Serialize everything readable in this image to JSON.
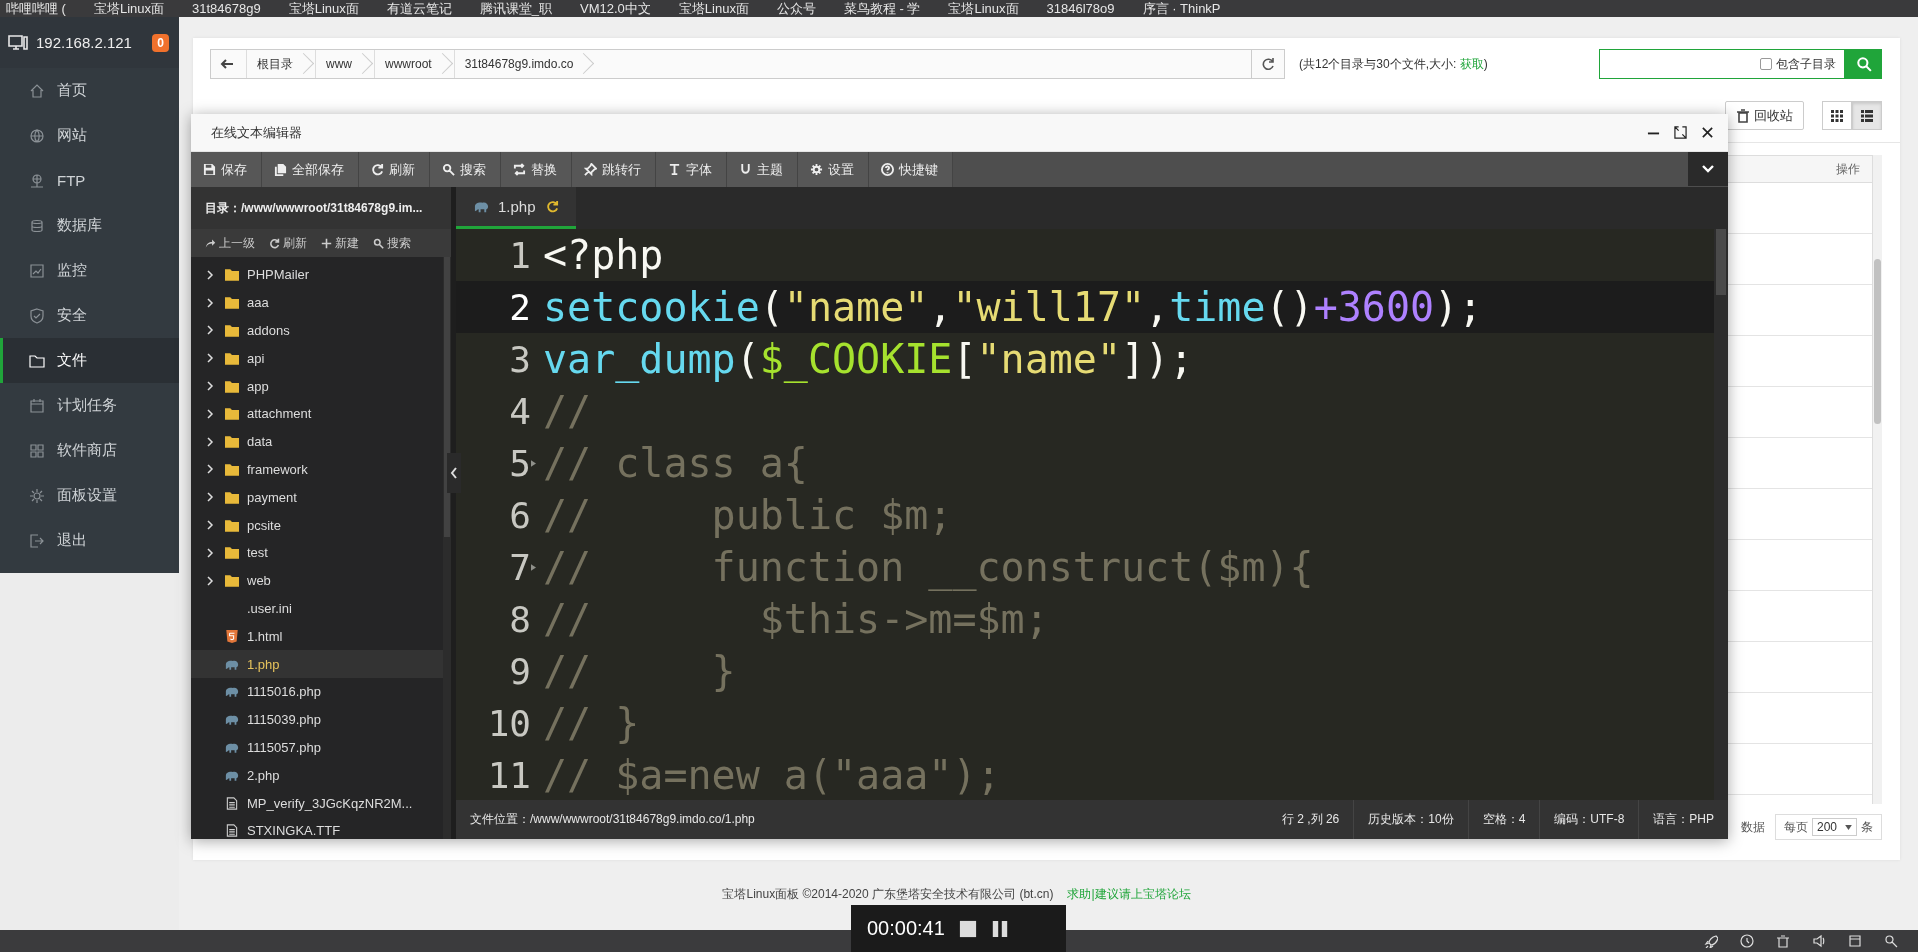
{
  "bookmarks": [
    {
      "label": "哔哩哔哩 ("
    },
    {
      "label": "宝塔Linux面"
    },
    {
      "label": "31t84678g9"
    },
    {
      "label": "宝塔Linux面"
    },
    {
      "label": "有道云笔记"
    },
    {
      "label": "腾讯课堂_职"
    },
    {
      "label": "VM12.0中文"
    },
    {
      "label": "宝塔Linux面"
    },
    {
      "label": "公众号"
    },
    {
      "label": "菜鸟教程 - 学"
    },
    {
      "label": "宝塔Linux面"
    },
    {
      "label": "31846l78o9"
    },
    {
      "label": "序言 · ThinkP"
    }
  ],
  "sidebar": {
    "host": "192.168.2.121",
    "badge": "0",
    "items": [
      {
        "label": "首页",
        "selected": false
      },
      {
        "label": "网站",
        "selected": false
      },
      {
        "label": "FTP",
        "selected": false
      },
      {
        "label": "数据库",
        "selected": false
      },
      {
        "label": "监控",
        "selected": false
      },
      {
        "label": "安全",
        "selected": false
      },
      {
        "label": "文件",
        "selected": true
      },
      {
        "label": "计划任务",
        "selected": false
      },
      {
        "label": "软件商店",
        "selected": false
      },
      {
        "label": "面板设置",
        "selected": false
      },
      {
        "label": "退出",
        "selected": false
      }
    ]
  },
  "breadcrumb": {
    "parts": [
      "根目录",
      "www",
      "wwwroot",
      "31t84678g9.imdo.co"
    ],
    "summary_start": "(共12个目录与30个文件,大小: ",
    "summary_link": "获取",
    "summary_end": ")"
  },
  "search": {
    "checkbox_label": "包含子目录",
    "checked": false
  },
  "page_toolbar": {
    "recycle": "回收站",
    "views": [
      {
        "selected": false
      },
      {
        "selected": true
      }
    ]
  },
  "table": {
    "header": "操作"
  },
  "pager": {
    "count_tail": "数据",
    "per_page_label": "每页",
    "per_page": "200",
    "unit": "条"
  },
  "editor": {
    "title": "在线文本编辑器",
    "toolbar": [
      "保存",
      "全部保存",
      "刷新",
      "搜索",
      "替换",
      "跳转行",
      "字体",
      "主题",
      "设置",
      "快捷键"
    ],
    "directory": "目录：/www/wwwroot/31t84678g9.im...",
    "actions": [
      "上一级",
      "刷新",
      "新建",
      "搜索"
    ],
    "tree": [
      {
        "name": "PHPMailer",
        "kind": "folder",
        "expanded": false,
        "selected": false
      },
      {
        "name": "aaa",
        "kind": "folder",
        "expanded": false,
        "selected": false
      },
      {
        "name": "addons",
        "kind": "folder",
        "expanded": false,
        "selected": false
      },
      {
        "name": "api",
        "kind": "folder",
        "expanded": false,
        "selected": false
      },
      {
        "name": "app",
        "kind": "folder",
        "expanded": false,
        "selected": false
      },
      {
        "name": "attachment",
        "kind": "folder",
        "expanded": false,
        "selected": false
      },
      {
        "name": "data",
        "kind": "folder",
        "expanded": false,
        "selected": false
      },
      {
        "name": "framework",
        "kind": "folder",
        "expanded": false,
        "selected": false
      },
      {
        "name": "payment",
        "kind": "folder",
        "expanded": false,
        "selected": false
      },
      {
        "name": "pcsite",
        "kind": "folder",
        "expanded": false,
        "selected": false
      },
      {
        "name": "test",
        "kind": "folder",
        "expanded": false,
        "selected": false
      },
      {
        "name": "web",
        "kind": "folder",
        "expanded": false,
        "selected": false
      },
      {
        "name": ".user.ini",
        "kind": "plain",
        "selected": false
      },
      {
        "name": "1.html",
        "kind": "html",
        "selected": false
      },
      {
        "name": "1.php",
        "kind": "php",
        "selected": true
      },
      {
        "name": "1115016.php",
        "kind": "php",
        "selected": false
      },
      {
        "name": "1115039.php",
        "kind": "php",
        "selected": false
      },
      {
        "name": "1115057.php",
        "kind": "php",
        "selected": false
      },
      {
        "name": "2.php",
        "kind": "php",
        "selected": false
      },
      {
        "name": "MP_verify_3JGcKqzNR2M...",
        "kind": "document",
        "selected": false
      },
      {
        "name": "STXINGKA.TTF",
        "kind": "document",
        "selected": false
      }
    ],
    "tabs": [
      {
        "label": "1.php",
        "selected": true
      }
    ],
    "lines": [
      {
        "number": "1",
        "current": false,
        "foldable": false,
        "tokens": [
          {
            "t": "<?php",
            "kind": "plain"
          }
        ]
      },
      {
        "number": "2",
        "current": true,
        "foldable": false,
        "tokens": [
          {
            "t": "setcookie",
            "kind": "func"
          },
          {
            "t": "(",
            "kind": "plain"
          },
          {
            "t": "\"name\"",
            "kind": "string"
          },
          {
            "t": ",",
            "kind": "plain"
          },
          {
            "t": "\"will17\"",
            "kind": "string"
          },
          {
            "t": ",",
            "kind": "plain"
          },
          {
            "t": "time",
            "kind": "func"
          },
          {
            "t": "()",
            "kind": "plain"
          },
          {
            "t": "+3600",
            "kind": "number"
          },
          {
            "t": ");",
            "kind": "plain"
          }
        ]
      },
      {
        "number": "3",
        "current": false,
        "foldable": false,
        "tokens": [
          {
            "t": "var_dump",
            "kind": "func"
          },
          {
            "t": "(",
            "kind": "plain"
          },
          {
            "t": "$_COOKIE",
            "kind": "var"
          },
          {
            "t": "[",
            "kind": "plain"
          },
          {
            "t": "\"name\"",
            "kind": "string"
          },
          {
            "t": "]);",
            "kind": "plain"
          }
        ]
      },
      {
        "number": "4",
        "current": false,
        "foldable": false,
        "tokens": [
          {
            "t": "//",
            "kind": "comment"
          }
        ]
      },
      {
        "number": "5",
        "current": false,
        "foldable": true,
        "tokens": [
          {
            "t": "// class a{",
            "kind": "comment"
          }
        ]
      },
      {
        "number": "6",
        "current": false,
        "foldable": false,
        "tokens": [
          {
            "t": "//     public $m;",
            "kind": "comment"
          }
        ]
      },
      {
        "number": "7",
        "current": false,
        "foldable": true,
        "tokens": [
          {
            "t": "//     function __construct($m){",
            "kind": "comment"
          }
        ]
      },
      {
        "number": "8",
        "current": false,
        "foldable": false,
        "tokens": [
          {
            "t": "//       $this->m=$m;",
            "kind": "comment"
          }
        ]
      },
      {
        "number": "9",
        "current": false,
        "foldable": false,
        "tokens": [
          {
            "t": "//     }",
            "kind": "comment"
          }
        ]
      },
      {
        "number": "10",
        "current": false,
        "foldable": false,
        "tokens": [
          {
            "t": "// }",
            "kind": "comment"
          }
        ]
      },
      {
        "number": "11",
        "current": false,
        "foldable": false,
        "tokens": [
          {
            "t": "// $a=new a(\"aaa\");",
            "kind": "comment"
          }
        ]
      }
    ],
    "status": {
      "path": "文件位置：/www/wwwroot/31t84678g9.imdo.co/1.php",
      "position": "行 2 ,列 26",
      "history": "历史版本：10份",
      "indent": "空格：4",
      "encoding": "编码：UTF-8",
      "language": "语言：PHP"
    }
  },
  "footer": {
    "copyright": "宝塔Linux面板 ©2014-2020 广东堡塔安全技术有限公司 (bt.cn)",
    "link": "求助|建议请上宝塔论坛"
  },
  "recorder": {
    "time": "00:00:41"
  }
}
